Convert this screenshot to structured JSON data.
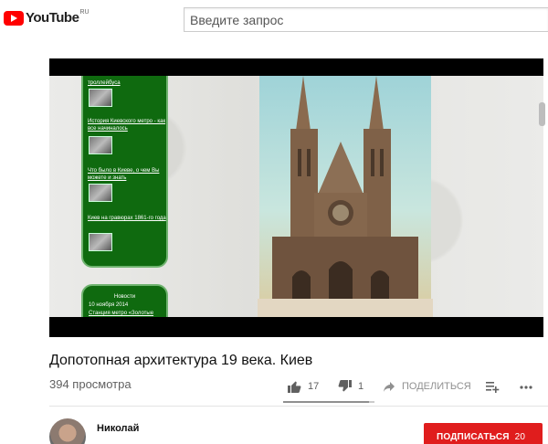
{
  "header": {
    "logo_text": "YouTube",
    "logo_region": "RU",
    "search_placeholder": "Введите запрос"
  },
  "player": {
    "panel_links": [
      "троллейбуса",
      "История Киевского метро - как все начиналось",
      "Что было в Киеве, о чем Вы можете и знать",
      "Киев на гравюрах 1861-го года"
    ],
    "news_title": "Новости",
    "news_date": "10 ноября 2014",
    "news_link": "Станция метро «Золотые ворота» опять в списке"
  },
  "video": {
    "title": "Допотопная архитектура 19 века. Киев",
    "views": "394 просмотра",
    "likes": "17",
    "dislikes": "1",
    "share_label": "ПОДЕЛИТЬСЯ",
    "like_ratio": 0.94
  },
  "channel": {
    "name": "Николай",
    "subscribe_label": "ПОДПИСАТЬСЯ",
    "subscriber_count": "20"
  },
  "colors": {
    "brand_red": "#ff0000",
    "subscribe_red": "#e01d1d",
    "panel_green": "#0f6a0f"
  }
}
